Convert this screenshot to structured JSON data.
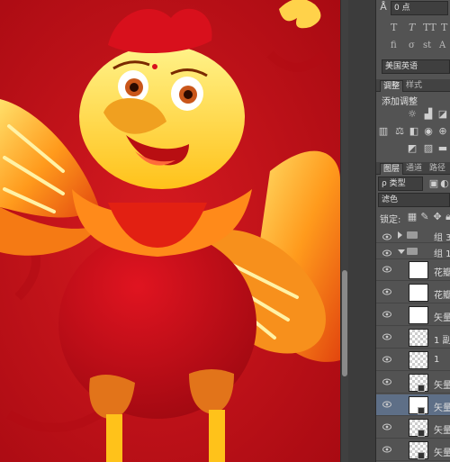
{
  "character": {
    "options_value": "0 点",
    "language_value": "美国英语"
  },
  "adjustments": {
    "tabs": [
      "调整",
      "样式"
    ],
    "add_label": "添加调整"
  },
  "layers_panel": {
    "tabs": [
      "图层",
      "通道",
      "路径"
    ],
    "kind_filter": "ρ 类型",
    "blend_mode": "滤色",
    "lock_label": "锁定:",
    "groups": [
      {
        "name": "组 3",
        "expanded": false
      },
      {
        "name": "组 1",
        "expanded": true
      }
    ],
    "layers": [
      {
        "name": "花瓣",
        "thumb": "white",
        "smart": false,
        "selected": false
      },
      {
        "name": "花瓣",
        "thumb": "white",
        "smart": false,
        "selected": false
      },
      {
        "name": "矢量",
        "thumb": "white",
        "smart": false,
        "selected": false
      },
      {
        "name": "1 副",
        "thumb": "checker",
        "smart": false,
        "selected": false
      },
      {
        "name": "1",
        "thumb": "checker",
        "smart": false,
        "selected": false
      },
      {
        "name": "矢量",
        "thumb": "checker",
        "smart": true,
        "selected": false
      },
      {
        "name": "矢量",
        "thumb": "white",
        "smart": true,
        "selected": true
      },
      {
        "name": "矢量",
        "thumb": "checker",
        "smart": true,
        "selected": false
      },
      {
        "name": "矢量",
        "thumb": "checker",
        "smart": true,
        "selected": false
      }
    ]
  },
  "colors": {
    "canvas_bg": "#c4111a",
    "panel_bg": "#535353",
    "selection": "#5e6f87"
  }
}
